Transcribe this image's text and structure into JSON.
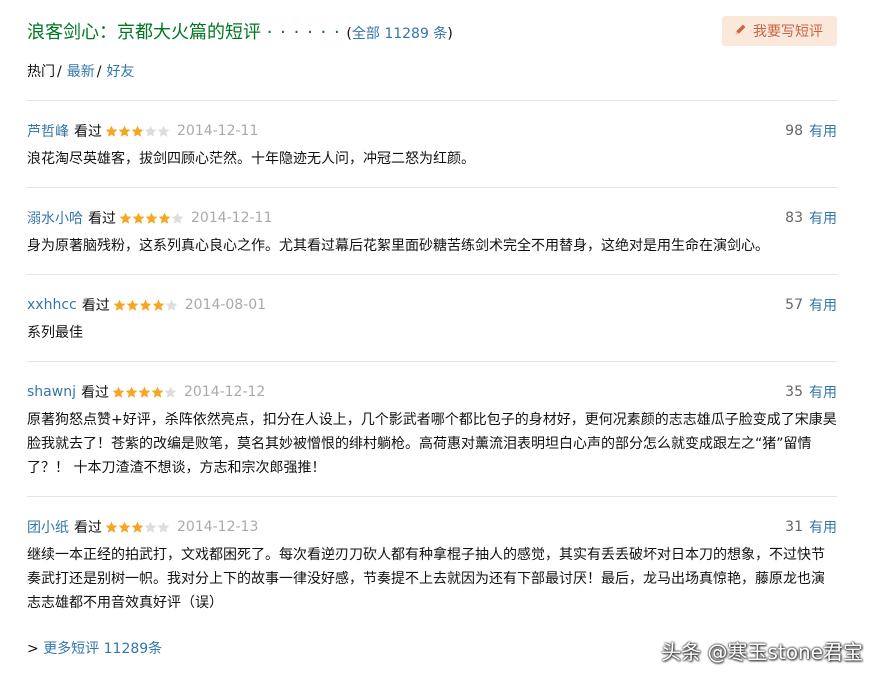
{
  "header": {
    "title": "浪客剑心：京都大火篇的短评",
    "dots": "· · · · · ·",
    "count_open": "(",
    "count_link": "全部 11289 条",
    "count_close": ")",
    "write_button": "我要写短评",
    "write_icon": "pencil-icon"
  },
  "filters": {
    "hot": "热门",
    "sep1": "/",
    "latest": "最新",
    "sep2": "/",
    "friends": "好友"
  },
  "colors": {
    "title_green": "#007722",
    "link_blue": "#3377aa",
    "star_orange": "#f5a623",
    "star_gray": "#dddddd",
    "button_bg": "#fae9da",
    "button_text": "#ca6445"
  },
  "comments": [
    {
      "user": "芦哲峰",
      "seen": "看过",
      "stars": 3,
      "date": "2014-12-11",
      "votes": "98",
      "vote_label": "有用",
      "content": "浪花淘尽英雄客，拔剑四顾心茫然。十年隐迹无人问，冲冠二怒为红颜。"
    },
    {
      "user": "溺水小哈",
      "seen": "看过",
      "stars": 4,
      "date": "2014-12-11",
      "votes": "83",
      "vote_label": "有用",
      "content": "身为原著脑残粉，这系列真心良心之作。尤其看过幕后花絮里面砂糖苦练剑术完全不用替身，这绝对是用生命在演剑心。"
    },
    {
      "user": "xxhhcc",
      "seen": "看过",
      "stars": 4,
      "date": "2014-08-01",
      "votes": "57",
      "vote_label": "有用",
      "content": "系列最佳"
    },
    {
      "user": "shawnj",
      "seen": "看过",
      "stars": 4,
      "date": "2014-12-12",
      "votes": "35",
      "vote_label": "有用",
      "content": "原著狗怒点赞+好评，杀阵依然亮点，扣分在人设上，几个影武者哪个都比包子的身材好，更何况素颜的志志雄瓜子脸变成了宋康昊脸我就去了！苍紫的改编是败笔，莫名其妙被憎恨的绯村躺枪。高荷惠对薰流泪表明坦白心声的部分怎么就变成跟左之“猪”留情了？！ 十本刀渣渣不想谈，方志和宗次郎强推！"
    },
    {
      "user": "团小纸",
      "seen": "看过",
      "stars": 3,
      "date": "2014-12-13",
      "votes": "31",
      "vote_label": "有用",
      "content": "继续一本正经的拍武打，文戏都困死了。每次看逆刃刀砍人都有种拿棍子抽人的感觉，其实有丢丢破坏对日本刀的想象，不过快节奏武打还是别树一帜。我对分上下的故事一律没好感，节奏提不上去就因为还有下部最讨厌！最后，龙马出场真惊艳，藤原龙也演志志雄都不用音效真好评（误）"
    }
  ],
  "more": {
    "prefix": ">",
    "link": "更多短评 11289条"
  },
  "watermark": "头条 @寒玉stone君宝"
}
